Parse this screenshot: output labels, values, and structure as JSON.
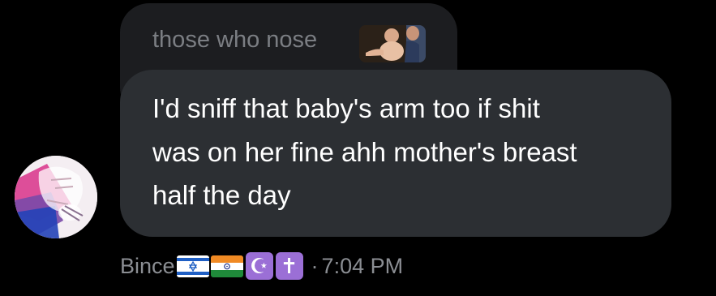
{
  "reply": {
    "text": "those who nose",
    "thumbnail_icon": "image-thumbnail"
  },
  "message": {
    "lines": [
      "I'd sniff that baby's arm too if shit",
      "was on her fine ahh mother's breast",
      "half the day"
    ]
  },
  "meta": {
    "username": "Bince",
    "flags": [
      "israel-flag-icon",
      "india-flag-icon"
    ],
    "symbols": [
      "☪",
      "✝"
    ],
    "separator": "·",
    "time": "7:04 PM"
  },
  "colors": {
    "background": "#000000",
    "reply_bubble": "#1c1d20",
    "main_bubble": "#2c2f33",
    "muted_text": "#8b8e93",
    "symbol_bg": "#9b6fd6"
  }
}
